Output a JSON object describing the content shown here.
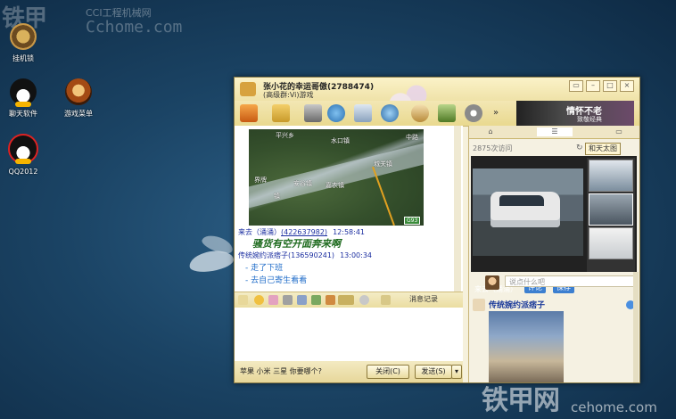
{
  "watermark": {
    "brand": "铁甲",
    "sub": "CCI工程机械网",
    "url": "Cchome.com",
    "brand_bottom": "铁甲网",
    "url_bottom": "cehome.com"
  },
  "desktop": {
    "icons": [
      {
        "label": "挂机锁"
      },
      {
        "label": "聊天软件"
      },
      {
        "label": "游戏菜单"
      },
      {
        "label": "QQ2012"
      }
    ]
  },
  "window": {
    "title": "张小花的幸运哥傲(2788474)",
    "subtitle": "(高级群:Vi)游戏",
    "toolbar_more": "»",
    "banner_text": "情怀不老",
    "banner_sub": "致敬经典"
  },
  "chat": {
    "map_labels": [
      "平兴乡",
      "水口镇",
      "中路",
      "城关镇",
      "界牌",
      "安谷镇",
      "嘉农镇",
      "镇"
    ],
    "map_road_badge": "G93",
    "messages": [
      {
        "name": "来去（涌涌）",
        "qq": "(422637982)",
        "time": "12:58:41"
      },
      {
        "name": "传统婉约派痞子",
        "qq": "(136590241)",
        "time": "13:00:34"
      }
    ],
    "shout": "骚货有空开面奔来啊",
    "lines": [
      "- 走了下班",
      "- 去自己寄生看看"
    ],
    "msg_record": "消息记录",
    "input_text": "苹果 小米 三星 你要哪个?",
    "close_btn": "关闭(C)",
    "send_btn": "发送(S)"
  },
  "right": {
    "visits": "2875次访问",
    "big_img_btn": "和天太图",
    "photo_caption": "来去（涌涌）",
    "comment_btn": "评论",
    "share_btn": "保存",
    "comment_placeholder": "说点什么吧",
    "feed_name": "传统婉约派痞子"
  }
}
